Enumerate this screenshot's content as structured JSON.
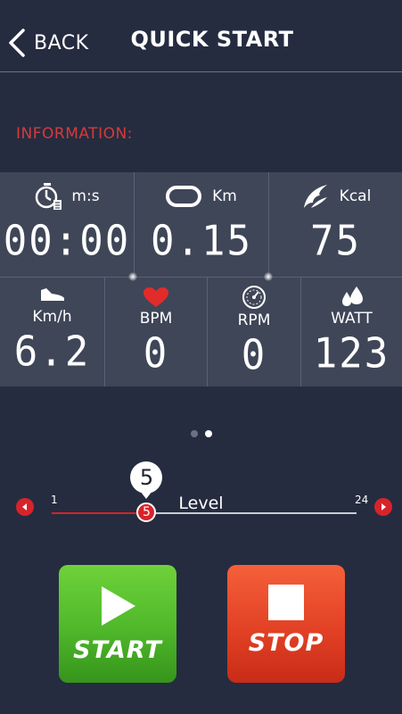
{
  "header": {
    "back_label": "BACK",
    "title": "QUICK START"
  },
  "section_label": "INFORMATION:",
  "metrics_row1": [
    {
      "unit": "m:s",
      "value": "00:00",
      "icon": "stopwatch-icon"
    },
    {
      "unit": "Km",
      "value": "0.15",
      "icon": "distance-track-icon"
    },
    {
      "unit": "Kcal",
      "value": "75",
      "icon": "calorie-wing-icon"
    }
  ],
  "metrics_row2": [
    {
      "unit": "Km/h",
      "value": "6.2",
      "icon": "sneaker-icon"
    },
    {
      "unit": "BPM",
      "value": "0",
      "icon": "heart-icon"
    },
    {
      "unit": "RPM",
      "value": "0",
      "icon": "speedometer-icon"
    },
    {
      "unit": "WATT",
      "value": "123",
      "icon": "water-drops-icon"
    }
  ],
  "pager": {
    "count": 2,
    "active_index": 1
  },
  "level": {
    "label": "Level",
    "min": "1",
    "max": "24",
    "current": "5",
    "bubble": "5",
    "current_value": 5,
    "min_value": 1,
    "max_value": 24
  },
  "buttons": {
    "start_label": "START",
    "stop_label": "STOP"
  },
  "colors": {
    "background": "#252c40",
    "panel": "#3f4658",
    "accent_red": "#d8232a",
    "start_green": "#4fb82a",
    "stop_red": "#e24125"
  }
}
